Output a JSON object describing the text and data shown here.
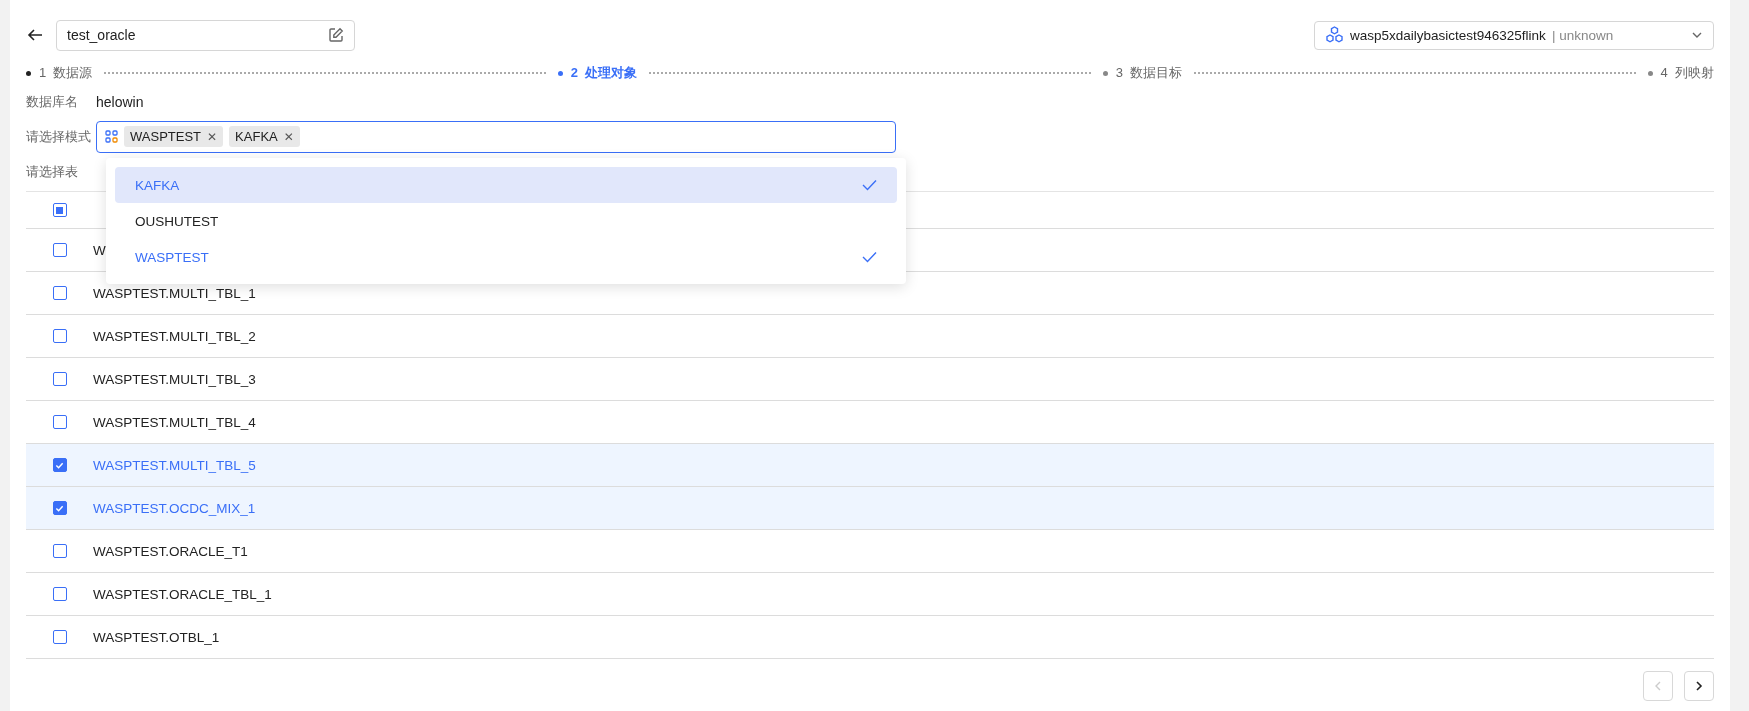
{
  "name_field": {
    "value": "test_oracle"
  },
  "cluster_select": {
    "name": "wasp5xdailybasictest946325flink",
    "separator": "|",
    "status": "unknown"
  },
  "steps": [
    {
      "number": "1",
      "label": "数据源",
      "selected": false
    },
    {
      "number": "2",
      "label": "处理对象",
      "selected": true
    },
    {
      "number": "3",
      "label": "数据目标",
      "selected": false
    },
    {
      "number": "4",
      "label": "列映射",
      "selected": false
    }
  ],
  "database": {
    "label": "数据库名",
    "value": "helowin"
  },
  "schema_select": {
    "label": "请选择模式",
    "tags": [
      "WASPTEST",
      "KAFKA"
    ],
    "close_glyph": "✕"
  },
  "schema_dropdown": [
    {
      "label": "KAFKA",
      "selected": true,
      "highlighted": true
    },
    {
      "label": "OUSHUTEST",
      "selected": false,
      "highlighted": false
    },
    {
      "label": "WASPTEST",
      "selected": true,
      "highlighted": false
    }
  ],
  "table_label": "请选择表",
  "table": {
    "header_indeterminate": true,
    "rows": [
      {
        "name": "W",
        "checked": false
      },
      {
        "name": "WASPTEST.MULTI_TBL_1",
        "checked": false
      },
      {
        "name": "WASPTEST.MULTI_TBL_2",
        "checked": false
      },
      {
        "name": "WASPTEST.MULTI_TBL_3",
        "checked": false
      },
      {
        "name": "WASPTEST.MULTI_TBL_4",
        "checked": false
      },
      {
        "name": "WASPTEST.MULTI_TBL_5",
        "checked": true
      },
      {
        "name": "WASPTEST.OCDC_MIX_1",
        "checked": true
      },
      {
        "name": "WASPTEST.ORACLE_T1",
        "checked": false
      },
      {
        "name": "WASPTEST.ORACLE_TBL_1",
        "checked": false
      },
      {
        "name": "WASPTEST.OTBL_1",
        "checked": false
      }
    ]
  },
  "pagination": {
    "prev_disabled": true,
    "next_disabled": false
  }
}
